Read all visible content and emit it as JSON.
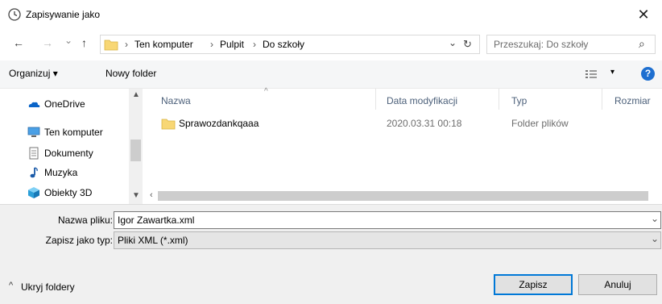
{
  "window": {
    "title": "Zapisywanie jako",
    "close_glyph": "✕"
  },
  "nav": {
    "back_glyph": "←",
    "forward_glyph": "→",
    "recent_glyph": "⌄",
    "up_glyph": "↑",
    "breadcrumb": [
      "Ten komputer",
      "Pulpit",
      "Do szkoły"
    ],
    "separator": "›",
    "refresh_glyph": "↻",
    "dropdown_glyph": "⌄",
    "search_placeholder": "Przeszukaj: Do szkoły",
    "search_glyph": "⌕"
  },
  "toolbar": {
    "organize_label": "Organizuj ▾",
    "new_folder_label": "Nowy folder",
    "view_glyph": "▾",
    "help_glyph": "?"
  },
  "sidebar": {
    "items": [
      {
        "label": "OneDrive",
        "icon": "onedrive-icon"
      },
      {
        "label": "Ten komputer",
        "icon": "computer-icon"
      },
      {
        "label": "Dokumenty",
        "icon": "documents-icon"
      },
      {
        "label": "Muzyka",
        "icon": "music-icon"
      },
      {
        "label": "Obiekty 3D",
        "icon": "objects-3d-icon"
      }
    ]
  },
  "files": {
    "columns": [
      "Nazwa",
      "Data modyfikacji",
      "Typ",
      "Rozmiar"
    ],
    "rows": [
      {
        "name": "Sprawozdankqaaa",
        "date": "2020.03.31 00:18",
        "type": "Folder plików",
        "size": ""
      }
    ]
  },
  "form": {
    "filename_label": "Nazwa pliku:",
    "filename_value": "Igor Zawartka.xml",
    "filetype_label": "Zapisz jako typ:",
    "filetype_value": "Pliki XML (*.xml)",
    "hide_folders_label": "Ukryj foldery",
    "save_label": "Zapisz",
    "cancel_label": "Anuluj"
  },
  "colors": {
    "accent": "#0078d7",
    "folder": "#f8d775",
    "help": "#1e6fd0"
  }
}
